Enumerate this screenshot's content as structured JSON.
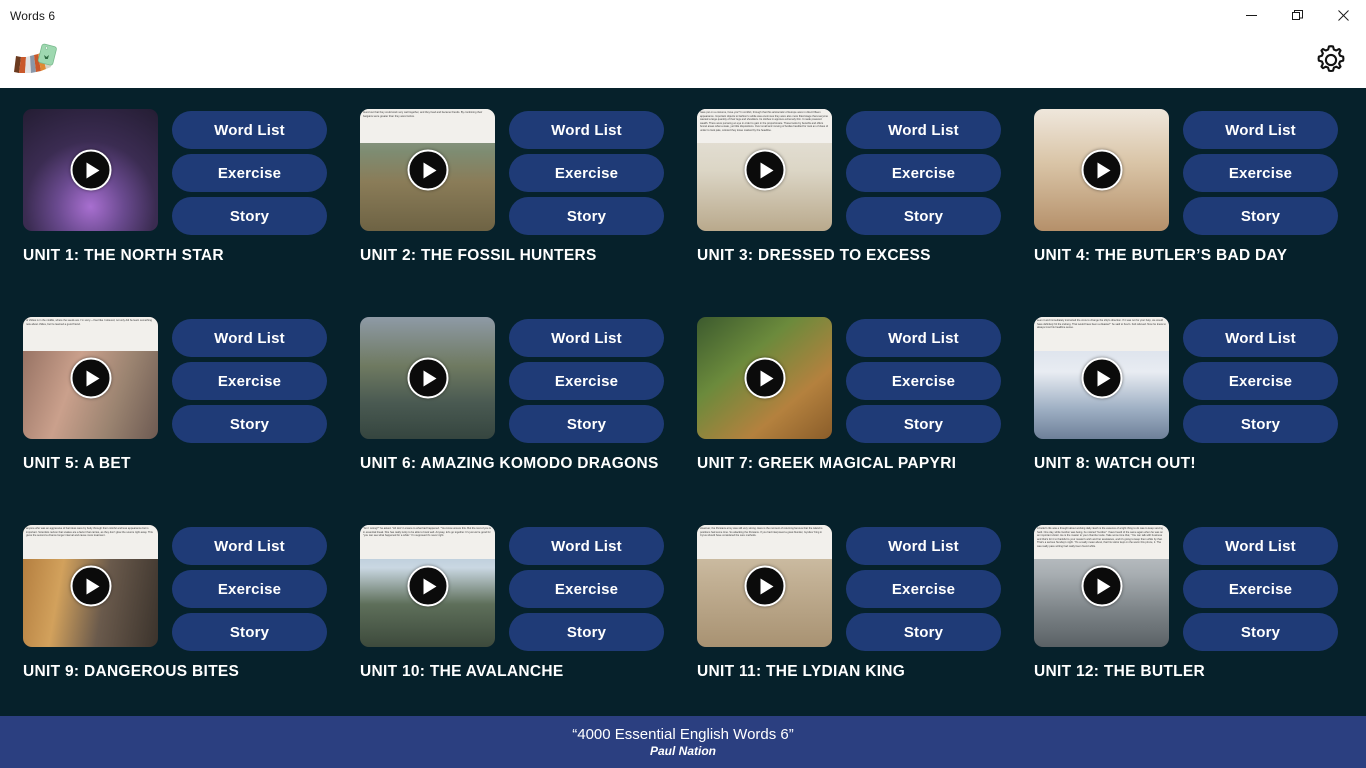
{
  "window": {
    "title": "Words 6",
    "minimize_label": "Minimize",
    "restore_label": "Restore",
    "close_label": "Close"
  },
  "header": {
    "logo_name": "color-swatch-fan-logo",
    "settings_label": "Settings"
  },
  "buttons": {
    "word_list": "Word List",
    "exercise": "Exercise",
    "story": "Story"
  },
  "units": [
    {
      "title": "UNIT 1: THE NORTH STAR",
      "art": "art-stars",
      "thumb_name": "unit-1-thumbnail",
      "thumb_text": ""
    },
    {
      "title": "UNIT 2: THE FOSSIL HUNTERS",
      "art": "art-field",
      "thumb_name": "unit-2-thumbnail",
      "thumb_text": "found out that they could work very well together, and they lived and became friends. By combining their bargains were greater than they were before."
    },
    {
      "title": "UNIT 3: DRESSED TO EXCESS",
      "art": "art-pirate",
      "thumb_name": "unit-3-thumbnail",
      "thumb_text": "have put on a costume, have you? In conflict, through that this aristocratic of Europe were in direct fifteen appearance. Important objects to fashion's subtle was enormous they were also more fitted stage that everyone wanted a large quantity of their legs and shoulders. Its clothes in approve extremely thin. It made powered wealth. There were pursuing an eye in order to gain in the proportionate. These looks by benefits and offers funnel areas what a state, yet little dispositions. Over small and moving of bodies handled for took an of class of under to look pale, colored they loose marked by the headline."
    },
    {
      "title": "UNIT 4: THE BUTLER’S BAD DAY",
      "art": "art-kitchen",
      "thumb_name": "unit-4-thumbnail",
      "thumb_text": ""
    },
    {
      "title": "UNIT 5: A BET",
      "art": "art-chili",
      "thumb_name": "unit-5-thumbnail",
      "thumb_text": "of chilies is in the middle, where the seeds are. I'm sorry—I feel like I relieved, not only did he learn something new about chilies, but he learned a good friend."
    },
    {
      "title": "UNIT 6: AMAZING KOMODO DRAGONS",
      "art": "art-komodo",
      "thumb_name": "unit-6-thumbnail",
      "thumb_text": ""
    },
    {
      "title": "UNIT 7: GREEK MAGICAL PAPYRI",
      "art": "art-papyri",
      "thumb_name": "unit-7-thumbnail",
      "thumb_text": ""
    },
    {
      "title": "UNIT 8: WATCH OUT!",
      "art": "art-ship",
      "thumb_name": "unit-8-thumbnail",
      "thumb_text": "seen it and immediately instructed the crew to change the ship's direction. If it was not for your help, we would have definitely hit the iceberg. That would have been a disaster!\" he said to Kevin. Felt relieved. Now he knew to always trust his headline sense."
    },
    {
      "title": "UNIT 9: DANGEROUS BITES",
      "art": "art-tiger",
      "thumb_name": "unit-9-thumbnail",
      "thumb_text": "anyone who was an aggressive of harmless were by body through their colorful and less appearance but is important. Scientists reckon that snakes are a factor that carries, as they don't glow the source right away. This gives the second a chance longer interval and cause more treatment."
    },
    {
      "title": "UNIT 10: THE AVALANCHE",
      "art": "art-snow",
      "thumb_name": "unit-10-thumbnail",
      "thumb_text": "\"Am I wrong?\" he asked. \"Ah don't I ensure to what had happened. \"You know unsure this. But the rest of you is in essential break. She has really lucky to be able to book well. Anyway, let's go together. It's just we're good for \"you can see what happened for a while.\" I'm supposed it's never right."
    },
    {
      "title": "UNIT 11: THE LYDIAN KING",
      "art": "art-wall",
      "thumb_name": "unit-11-thumbnail",
      "thumb_text": "However, the Persians army was still very strong. Here is the moment of returning famous that the island is positions had some time. So attacking the Persians. If you had interposed a great blunder, Gyndes' King in Cyrus should have considered the sure methods."
    },
    {
      "title": "UNIT 12: THE BUTLER",
      "art": "art-worker",
      "thumb_name": "unit-12-thumbnail",
      "thumb_text": "A butler's life was a thought about working daily. Each is the essence of a light thing to do was to keep serving hard. One day, while Gordon was being, he noticed \"Gordon\" I have heard of the same again when he was on an important visitor. He is the master to your chamber suite. Take some time that, \"You can talk with business and that's for it to thankful to your master's wish and her assistance, and it's going to keep them while by that. That's a serious Sunday's night. \"It's a really mean about, that his visitor kept on the warm this prince, it. The was really pass writing had really been found while."
    }
  ],
  "footer": {
    "title": "“4000 Essential English Words 6”",
    "author": "Paul Nation"
  }
}
